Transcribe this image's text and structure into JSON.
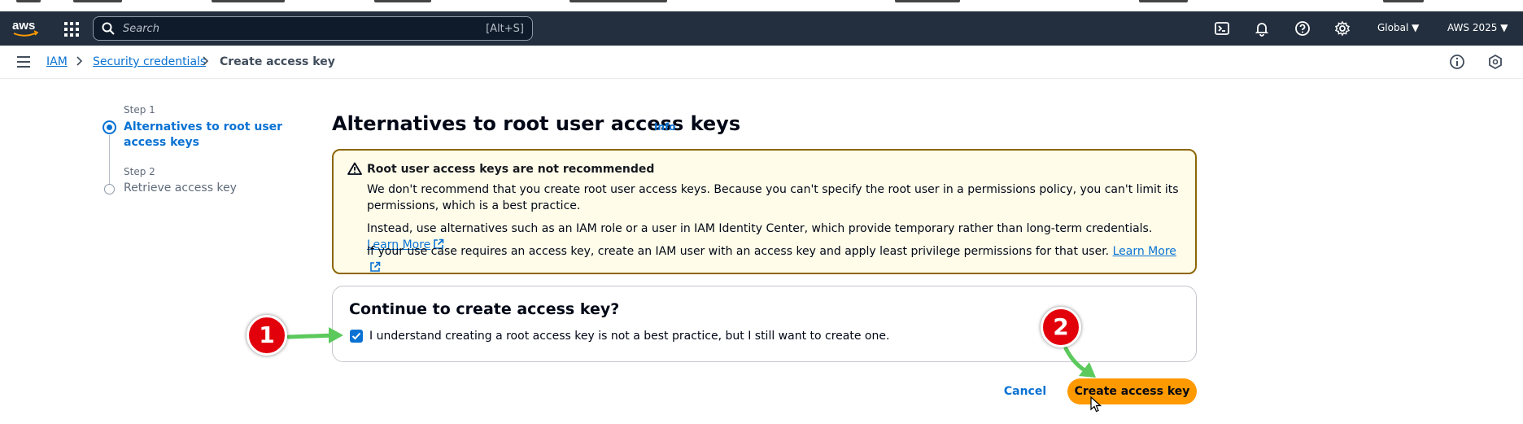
{
  "navbar": {
    "search_placeholder": "Search",
    "search_shortcut": "[Alt+S]",
    "region": "Global",
    "account": "AWS 2025"
  },
  "breadcrumb": {
    "items": [
      "IAM",
      "Security credentials"
    ],
    "current": "Create access key"
  },
  "steps": [
    {
      "label": "Step 1",
      "title": "Alternatives to root user access keys",
      "active": true
    },
    {
      "label": "Step 2",
      "title": "Retrieve access key",
      "active": false
    }
  ],
  "main": {
    "title": "Alternatives to root user access keys",
    "info": "Info",
    "alert": {
      "title": "Root user access keys are not recommended",
      "p1": "We don't recommend that you create root user access keys. Because you can't specify the root user in a permissions policy, you can't limit its permissions, which is a best practice.",
      "p2": "Instead, use alternatives such as an IAM role or a user in IAM Identity Center, which provide temporary rather than long-term credentials.",
      "p2_link": "Learn More",
      "p3": "If your use case requires an access key, create an IAM user with an access key and apply least privilege permissions for that user.",
      "p3_link": "Learn More"
    },
    "confirm": {
      "title": "Continue to create access key?",
      "checkbox_label": "I understand creating a root access key is not a best practice, but I still want to create one.",
      "checked": true
    },
    "cancel_label": "Cancel",
    "create_label": "Create access key"
  },
  "annotations": [
    "1",
    "2"
  ],
  "colors": {
    "navbar_bg": "#232f3e",
    "link": "#0972d3",
    "primary_button": "#ff9900",
    "warning_border": "#8d6605",
    "warning_bg": "#fffce9",
    "annotation_red": "#e2000b",
    "annotation_arrow": "#5cc95c"
  }
}
